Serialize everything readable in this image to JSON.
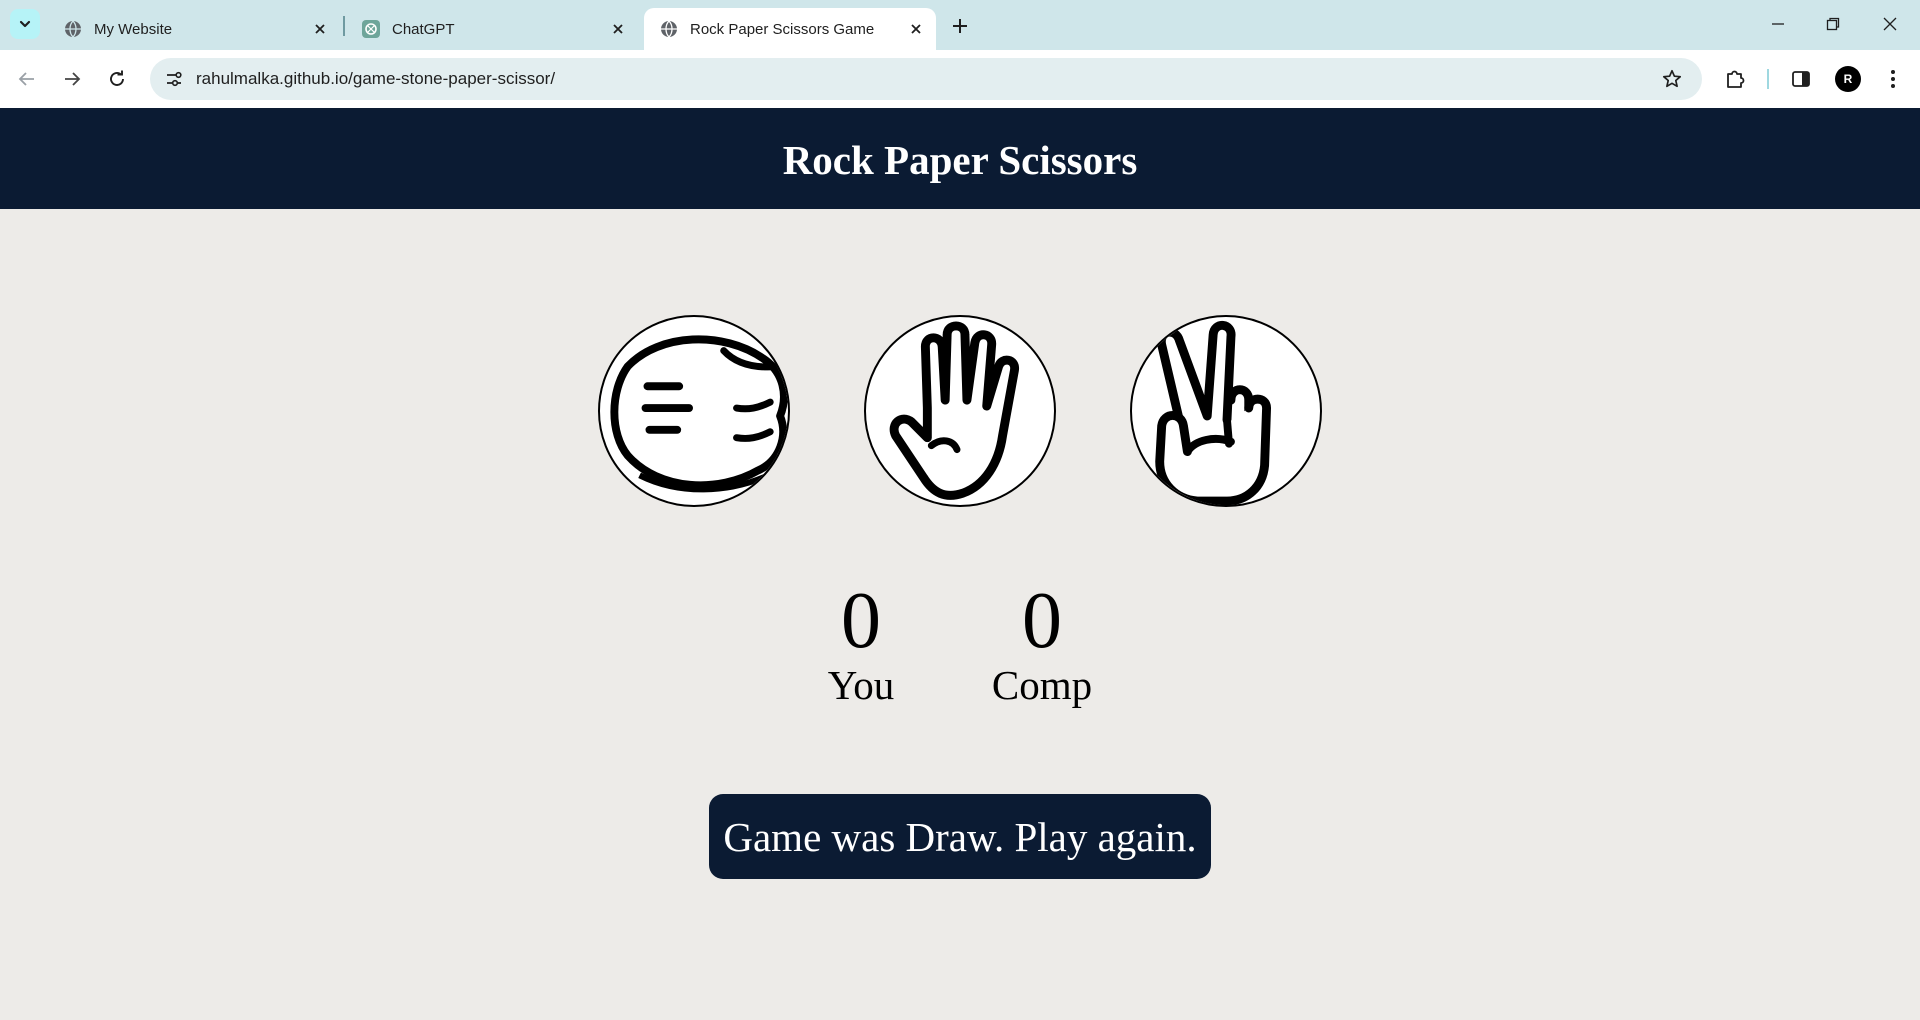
{
  "browser": {
    "tabs": [
      {
        "title": "My Website",
        "active": false,
        "icon": "globe-icon"
      },
      {
        "title": "ChatGPT",
        "active": false,
        "icon": "chatgpt-icon"
      },
      {
        "title": "Rock Paper Scissors Game",
        "active": true,
        "icon": "globe-icon"
      }
    ],
    "url": "rahulmalka.github.io/game-stone-paper-scissor/",
    "profile_initial": "R"
  },
  "page": {
    "title": "Rock Paper Scissors",
    "choices": [
      {
        "id": "rock",
        "icon": "rock-fist-icon"
      },
      {
        "id": "paper",
        "icon": "paper-hand-icon"
      },
      {
        "id": "scissors",
        "icon": "scissors-hand-icon"
      }
    ],
    "score": {
      "user_value": "0",
      "user_label": "You",
      "comp_value": "0",
      "comp_label": "Comp"
    },
    "message": "Game was Draw. Play again."
  },
  "colors": {
    "header_bg": "#0b1b33",
    "page_bg": "#edebe8",
    "tabstrip_bg": "#cfe6ea",
    "omnibox_bg": "#e3eef0"
  }
}
